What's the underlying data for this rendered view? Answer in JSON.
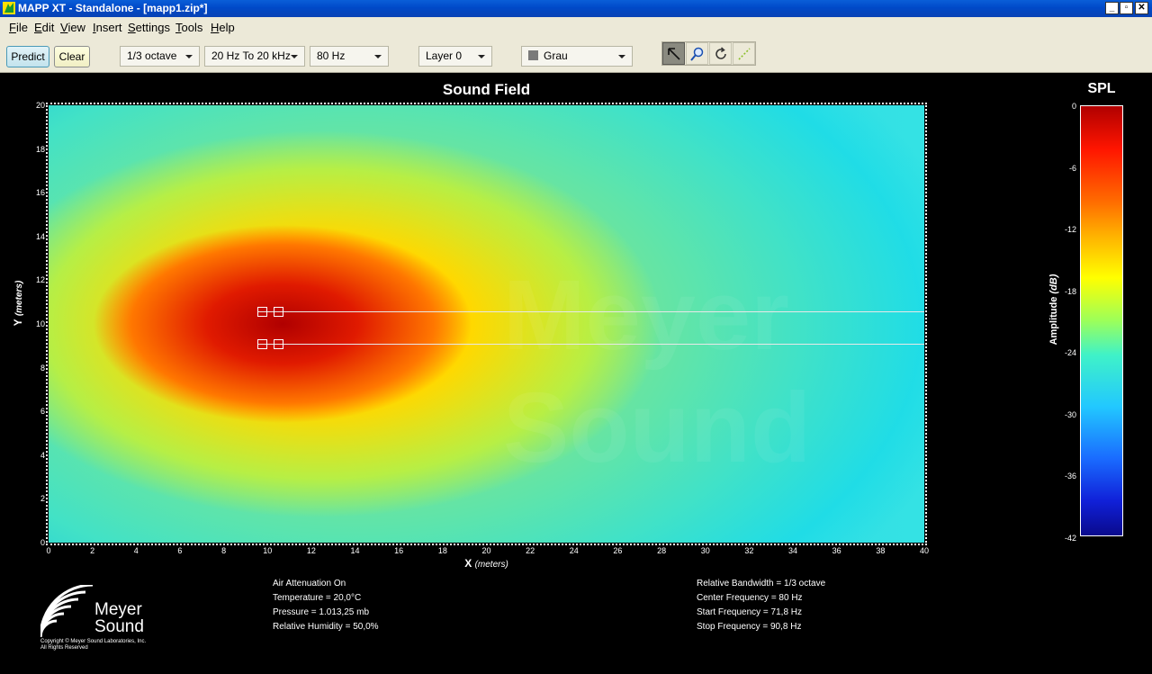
{
  "window": {
    "title": "MAPP XT - Standalone - [mapp1.zip*]"
  },
  "menu": [
    "File",
    "Edit",
    "View",
    "Insert",
    "Settings",
    "Tools",
    "Help"
  ],
  "menu_underline": [
    "F",
    "E",
    "V",
    "I",
    "S",
    "T",
    "H"
  ],
  "toolbar": {
    "predict_label": "Predict",
    "clear_label": "Clear",
    "bandwidth": "1/3 octave",
    "range": "20 Hz To 20 kHz",
    "frequency": "80 Hz",
    "layer": "Layer 0",
    "color": "Grau"
  },
  "plot": {
    "title": "Sound Field",
    "xlabel": "X",
    "xunit": "(meters)",
    "ylabel": "Y",
    "yunit": "(meters)",
    "xticks": [
      "0",
      "2",
      "4",
      "6",
      "8",
      "10",
      "12",
      "14",
      "16",
      "18",
      "20",
      "22",
      "24",
      "26",
      "28",
      "30",
      "32",
      "34",
      "36",
      "38",
      "40"
    ],
    "yticks": [
      "20",
      "18",
      "16",
      "14",
      "12",
      "10",
      "8",
      "6",
      "4",
      "2",
      "0"
    ]
  },
  "colorbar": {
    "title": "SPL",
    "label": "Amplitude",
    "unit": "(dB)",
    "ticks": [
      "0",
      "-6",
      "-12",
      "-18",
      "-24",
      "-30",
      "-36",
      "-42"
    ]
  },
  "watermark": {
    "line1": "Meyer",
    "line2": "Sound"
  },
  "logo": {
    "line1": "Meyer",
    "line2": "Sound",
    "copyright": "Copyright © Meyer Sound Laboratories, Inc.",
    "rights": "All Rights Reserved"
  },
  "conditions": [
    "Air Attenuation On",
    "Temperature = 20,0°C",
    "Pressure = 1.013,25  mb",
    "Relative Humidity = 50,0%"
  ],
  "frequency_info": [
    "Relative Bandwidth = 1/3 octave",
    "Center Frequency = 80 Hz",
    "Start Frequency = 71,8 Hz",
    "Stop Frequency = 90,8 Hz"
  ]
}
